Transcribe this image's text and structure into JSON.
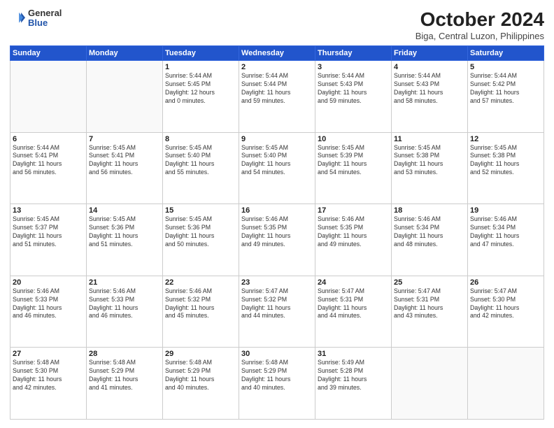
{
  "header": {
    "logo": {
      "general": "General",
      "blue": "Blue"
    },
    "title": "October 2024",
    "subtitle": "Biga, Central Luzon, Philippines"
  },
  "weekdays": [
    "Sunday",
    "Monday",
    "Tuesday",
    "Wednesday",
    "Thursday",
    "Friday",
    "Saturday"
  ],
  "weeks": [
    [
      {
        "day": "",
        "info": ""
      },
      {
        "day": "",
        "info": ""
      },
      {
        "day": "1",
        "info": "Sunrise: 5:44 AM\nSunset: 5:45 PM\nDaylight: 12 hours\nand 0 minutes."
      },
      {
        "day": "2",
        "info": "Sunrise: 5:44 AM\nSunset: 5:44 PM\nDaylight: 11 hours\nand 59 minutes."
      },
      {
        "day": "3",
        "info": "Sunrise: 5:44 AM\nSunset: 5:43 PM\nDaylight: 11 hours\nand 59 minutes."
      },
      {
        "day": "4",
        "info": "Sunrise: 5:44 AM\nSunset: 5:43 PM\nDaylight: 11 hours\nand 58 minutes."
      },
      {
        "day": "5",
        "info": "Sunrise: 5:44 AM\nSunset: 5:42 PM\nDaylight: 11 hours\nand 57 minutes."
      }
    ],
    [
      {
        "day": "6",
        "info": "Sunrise: 5:44 AM\nSunset: 5:41 PM\nDaylight: 11 hours\nand 56 minutes."
      },
      {
        "day": "7",
        "info": "Sunrise: 5:45 AM\nSunset: 5:41 PM\nDaylight: 11 hours\nand 56 minutes."
      },
      {
        "day": "8",
        "info": "Sunrise: 5:45 AM\nSunset: 5:40 PM\nDaylight: 11 hours\nand 55 minutes."
      },
      {
        "day": "9",
        "info": "Sunrise: 5:45 AM\nSunset: 5:40 PM\nDaylight: 11 hours\nand 54 minutes."
      },
      {
        "day": "10",
        "info": "Sunrise: 5:45 AM\nSunset: 5:39 PM\nDaylight: 11 hours\nand 54 minutes."
      },
      {
        "day": "11",
        "info": "Sunrise: 5:45 AM\nSunset: 5:38 PM\nDaylight: 11 hours\nand 53 minutes."
      },
      {
        "day": "12",
        "info": "Sunrise: 5:45 AM\nSunset: 5:38 PM\nDaylight: 11 hours\nand 52 minutes."
      }
    ],
    [
      {
        "day": "13",
        "info": "Sunrise: 5:45 AM\nSunset: 5:37 PM\nDaylight: 11 hours\nand 51 minutes."
      },
      {
        "day": "14",
        "info": "Sunrise: 5:45 AM\nSunset: 5:36 PM\nDaylight: 11 hours\nand 51 minutes."
      },
      {
        "day": "15",
        "info": "Sunrise: 5:45 AM\nSunset: 5:36 PM\nDaylight: 11 hours\nand 50 minutes."
      },
      {
        "day": "16",
        "info": "Sunrise: 5:46 AM\nSunset: 5:35 PM\nDaylight: 11 hours\nand 49 minutes."
      },
      {
        "day": "17",
        "info": "Sunrise: 5:46 AM\nSunset: 5:35 PM\nDaylight: 11 hours\nand 49 minutes."
      },
      {
        "day": "18",
        "info": "Sunrise: 5:46 AM\nSunset: 5:34 PM\nDaylight: 11 hours\nand 48 minutes."
      },
      {
        "day": "19",
        "info": "Sunrise: 5:46 AM\nSunset: 5:34 PM\nDaylight: 11 hours\nand 47 minutes."
      }
    ],
    [
      {
        "day": "20",
        "info": "Sunrise: 5:46 AM\nSunset: 5:33 PM\nDaylight: 11 hours\nand 46 minutes."
      },
      {
        "day": "21",
        "info": "Sunrise: 5:46 AM\nSunset: 5:33 PM\nDaylight: 11 hours\nand 46 minutes."
      },
      {
        "day": "22",
        "info": "Sunrise: 5:46 AM\nSunset: 5:32 PM\nDaylight: 11 hours\nand 45 minutes."
      },
      {
        "day": "23",
        "info": "Sunrise: 5:47 AM\nSunset: 5:32 PM\nDaylight: 11 hours\nand 44 minutes."
      },
      {
        "day": "24",
        "info": "Sunrise: 5:47 AM\nSunset: 5:31 PM\nDaylight: 11 hours\nand 44 minutes."
      },
      {
        "day": "25",
        "info": "Sunrise: 5:47 AM\nSunset: 5:31 PM\nDaylight: 11 hours\nand 43 minutes."
      },
      {
        "day": "26",
        "info": "Sunrise: 5:47 AM\nSunset: 5:30 PM\nDaylight: 11 hours\nand 42 minutes."
      }
    ],
    [
      {
        "day": "27",
        "info": "Sunrise: 5:48 AM\nSunset: 5:30 PM\nDaylight: 11 hours\nand 42 minutes."
      },
      {
        "day": "28",
        "info": "Sunrise: 5:48 AM\nSunset: 5:29 PM\nDaylight: 11 hours\nand 41 minutes."
      },
      {
        "day": "29",
        "info": "Sunrise: 5:48 AM\nSunset: 5:29 PM\nDaylight: 11 hours\nand 40 minutes."
      },
      {
        "day": "30",
        "info": "Sunrise: 5:48 AM\nSunset: 5:29 PM\nDaylight: 11 hours\nand 40 minutes."
      },
      {
        "day": "31",
        "info": "Sunrise: 5:49 AM\nSunset: 5:28 PM\nDaylight: 11 hours\nand 39 minutes."
      },
      {
        "day": "",
        "info": ""
      },
      {
        "day": "",
        "info": ""
      }
    ]
  ]
}
